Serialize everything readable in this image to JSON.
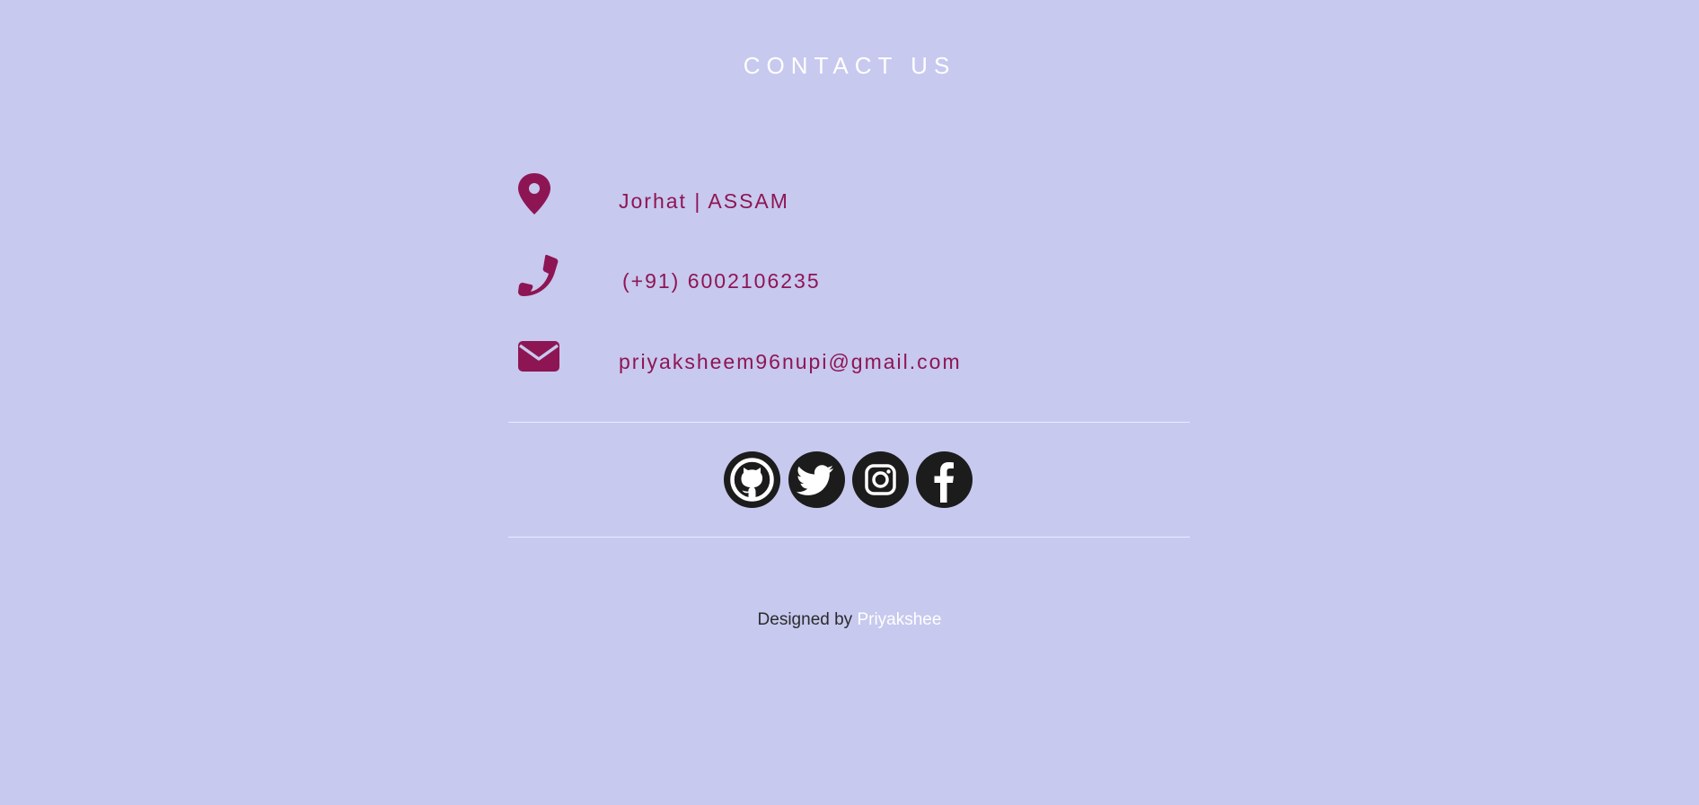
{
  "page": {
    "title": "CONTACT US"
  },
  "contacts": {
    "location": {
      "icon": "location-pin-icon",
      "text": "Jorhat | ASSAM"
    },
    "phone": {
      "icon": "phone-icon",
      "text": "(+91) 6002106235"
    },
    "email": {
      "icon": "envelope-icon",
      "text": "priyaksheem96nupi@gmail.com"
    }
  },
  "social": [
    {
      "name": "GitHub",
      "icon": "github-icon"
    },
    {
      "name": "Twitter",
      "icon": "twitter-icon"
    },
    {
      "name": "Instagram",
      "icon": "instagram-icon"
    },
    {
      "name": "Facebook",
      "icon": "facebook-icon"
    }
  ],
  "footer": {
    "prefix": "Designed by",
    "author": "Priyakshee"
  },
  "colors": {
    "background": "#c7c9ef",
    "accent": "#8e1553",
    "title": "#ffffff",
    "social_bg": "#1c1c1c"
  }
}
